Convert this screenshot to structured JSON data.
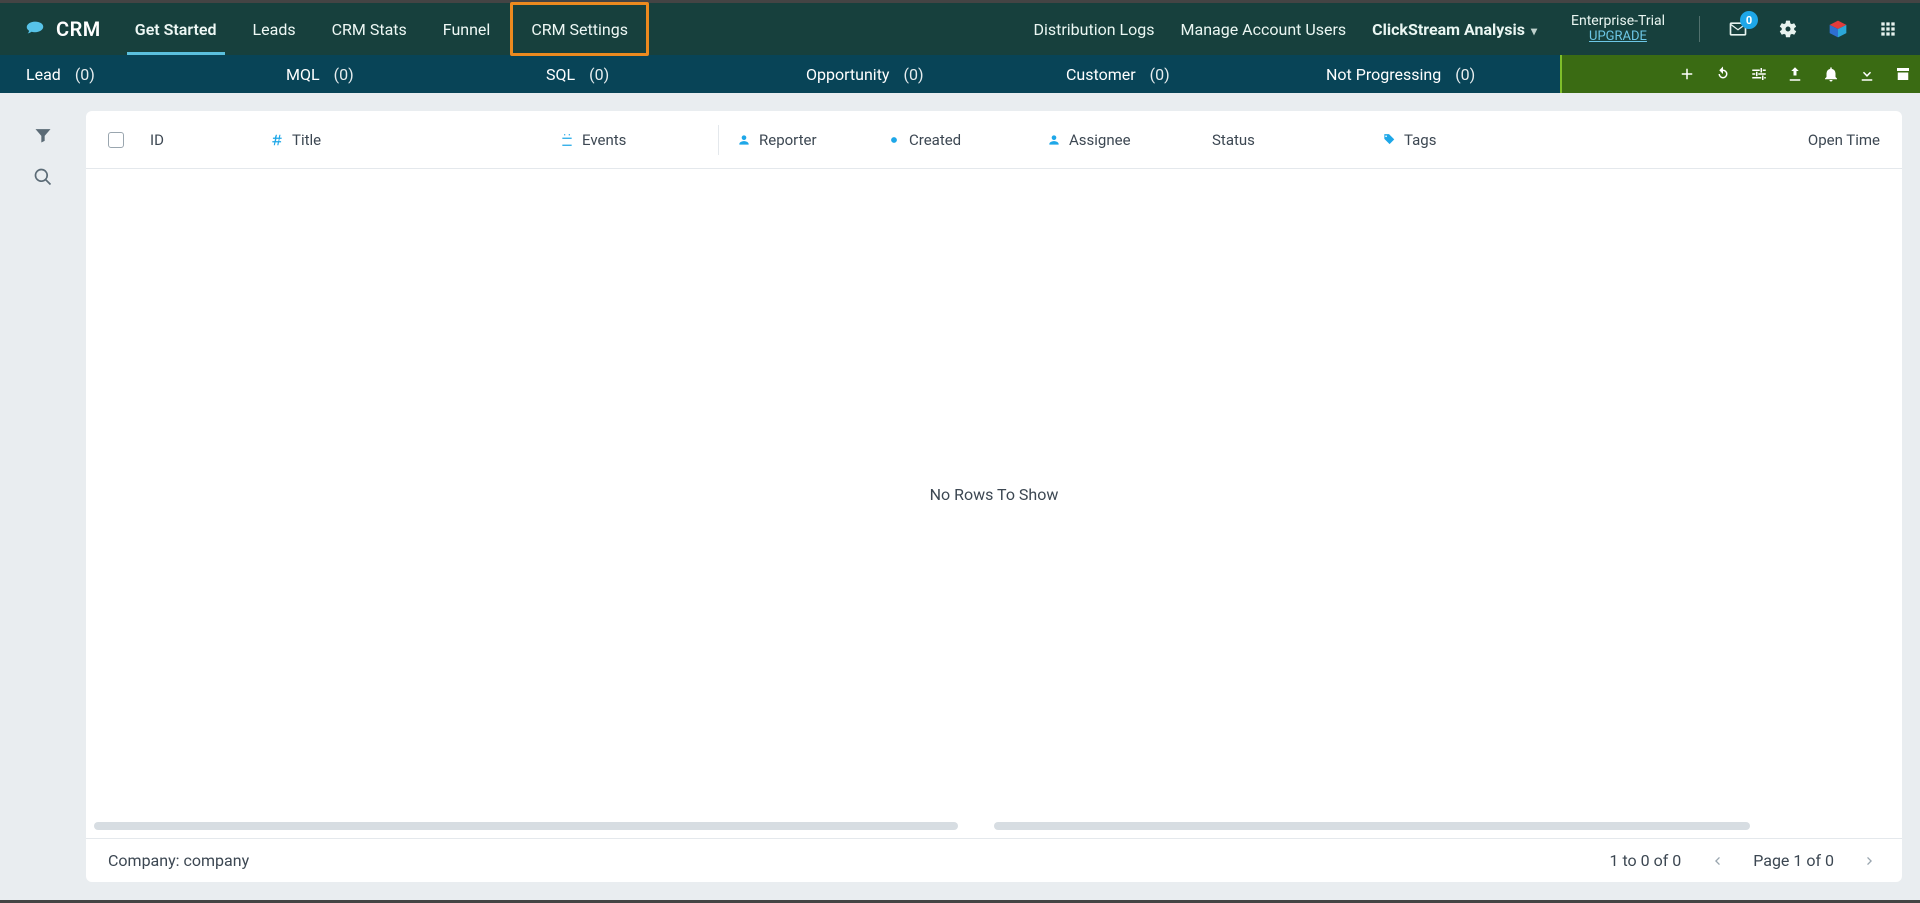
{
  "brand": "CRM",
  "nav": {
    "tabs": [
      {
        "label": "Get Started",
        "active": true
      },
      {
        "label": "Leads",
        "active": false
      },
      {
        "label": "CRM Stats",
        "active": false
      },
      {
        "label": "Funnel",
        "active": false
      },
      {
        "label": "CRM Settings",
        "active": false,
        "highlight": true
      }
    ],
    "right": [
      {
        "label": "Distribution Logs"
      },
      {
        "label": "Manage Account Users"
      },
      {
        "label": "ClickStream Analysis",
        "dropdown": true,
        "strong": true
      }
    ],
    "account": {
      "tier": "Enterprise-Trial",
      "upgrade": "UPGRADE"
    },
    "inbox_badge": "0"
  },
  "stages": [
    {
      "name": "Lead",
      "count": "(0)"
    },
    {
      "name": "MQL",
      "count": "(0)"
    },
    {
      "name": "SQL",
      "count": "(0)"
    },
    {
      "name": "Opportunity",
      "count": "(0)"
    },
    {
      "name": "Customer",
      "count": "(0)"
    },
    {
      "name": "Not Progressing",
      "count": "(0)"
    }
  ],
  "columns": {
    "id": "ID",
    "title": "Title",
    "events": "Events",
    "reporter": "Reporter",
    "created": "Created",
    "assignee": "Assignee",
    "status": "Status",
    "tags": "Tags",
    "open_time": "Open Time"
  },
  "empty": "No Rows To Show",
  "footer": {
    "breadcrumb": "Company: company",
    "range": "1 to 0 of 0",
    "page": "Page 1 of 0"
  }
}
